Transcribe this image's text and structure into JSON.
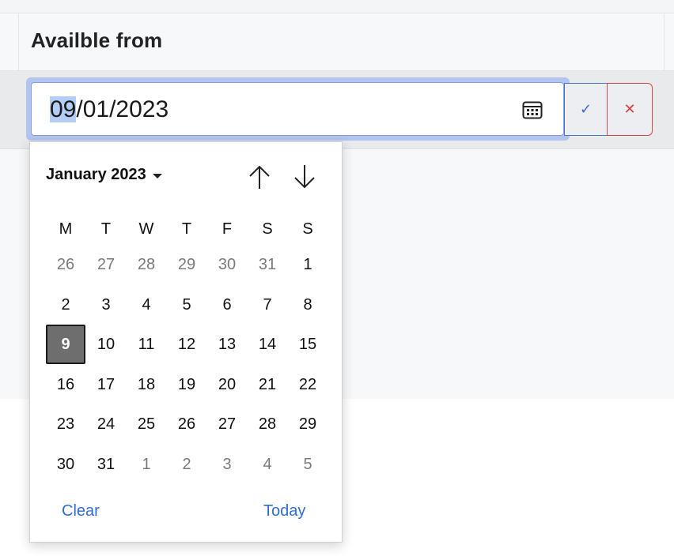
{
  "table": {
    "column_header": "Availble from"
  },
  "date_input": {
    "value_selected": "09",
    "value_rest": "/01/2023"
  },
  "icons": {
    "calendar": "calendar-icon",
    "confirm": "check-icon",
    "cancel": "close-icon",
    "up": "arrow-up-icon",
    "down": "arrow-down-icon"
  },
  "actions": {
    "confirm_glyph": "✓",
    "cancel_glyph": "✕"
  },
  "calendar": {
    "month_label": "January 2023",
    "weekdays": [
      "M",
      "T",
      "W",
      "T",
      "F",
      "S",
      "S"
    ],
    "weeks": [
      [
        {
          "d": "26",
          "m": true
        },
        {
          "d": "27",
          "m": true
        },
        {
          "d": "28",
          "m": true
        },
        {
          "d": "29",
          "m": true
        },
        {
          "d": "30",
          "m": true
        },
        {
          "d": "31",
          "m": true
        },
        {
          "d": "1"
        }
      ],
      [
        {
          "d": "2"
        },
        {
          "d": "3"
        },
        {
          "d": "4"
        },
        {
          "d": "5"
        },
        {
          "d": "6"
        },
        {
          "d": "7"
        },
        {
          "d": "8"
        }
      ],
      [
        {
          "d": "9",
          "s": true
        },
        {
          "d": "10"
        },
        {
          "d": "11"
        },
        {
          "d": "12"
        },
        {
          "d": "13"
        },
        {
          "d": "14"
        },
        {
          "d": "15"
        }
      ],
      [
        {
          "d": "16"
        },
        {
          "d": "17"
        },
        {
          "d": "18"
        },
        {
          "d": "19"
        },
        {
          "d": "20"
        },
        {
          "d": "21"
        },
        {
          "d": "22"
        }
      ],
      [
        {
          "d": "23"
        },
        {
          "d": "24"
        },
        {
          "d": "25"
        },
        {
          "d": "26"
        },
        {
          "d": "27"
        },
        {
          "d": "28"
        },
        {
          "d": "29"
        }
      ],
      [
        {
          "d": "30"
        },
        {
          "d": "31"
        },
        {
          "d": "1",
          "m": true
        },
        {
          "d": "2",
          "m": true
        },
        {
          "d": "3",
          "m": true
        },
        {
          "d": "4",
          "m": true
        },
        {
          "d": "5",
          "m": true
        }
      ]
    ],
    "clear_label": "Clear",
    "today_label": "Today"
  },
  "colors": {
    "accent": "#2f6fd0",
    "cancel": "#d14040",
    "selected_day": "#6e6e6e"
  }
}
